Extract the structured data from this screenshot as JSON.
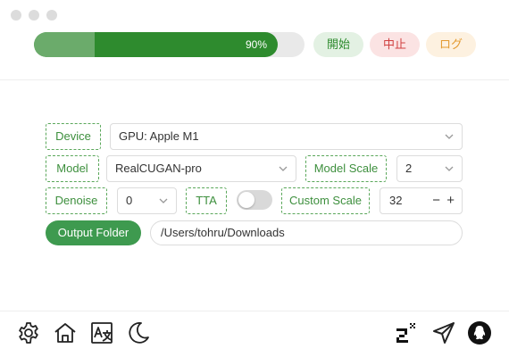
{
  "window": {
    "traffic_lights": [
      "close",
      "minimize",
      "zoom"
    ]
  },
  "progress": {
    "percent": 90,
    "label": "90%",
    "color": "#2e8b2e"
  },
  "actions": {
    "start_label": "開始",
    "stop_label": "中止",
    "log_label": "ログ"
  },
  "device": {
    "label": "Device",
    "value": "GPU: Apple M1"
  },
  "model": {
    "label": "Model",
    "value": "RealCUGAN-pro"
  },
  "model_scale": {
    "label": "Model Scale",
    "value": "2"
  },
  "denoise": {
    "label": "Denoise",
    "value": "0"
  },
  "tta": {
    "label": "TTA",
    "enabled": false
  },
  "custom_scale": {
    "label": "Custom Scale",
    "value": "32",
    "minus": "−",
    "plus": "+"
  },
  "output": {
    "button_label": "Output Folder",
    "path": "/Users/tohru/Downloads"
  },
  "bottom_icons": {
    "left": [
      "gear-icon",
      "home-icon",
      "translate-icon",
      "moon-icon"
    ],
    "right": [
      "z2x-logo-icon",
      "send-icon",
      "qq-icon"
    ]
  },
  "colors": {
    "accent": "#3e9a4f",
    "stop": "#d04040",
    "log": "#e39a30"
  }
}
